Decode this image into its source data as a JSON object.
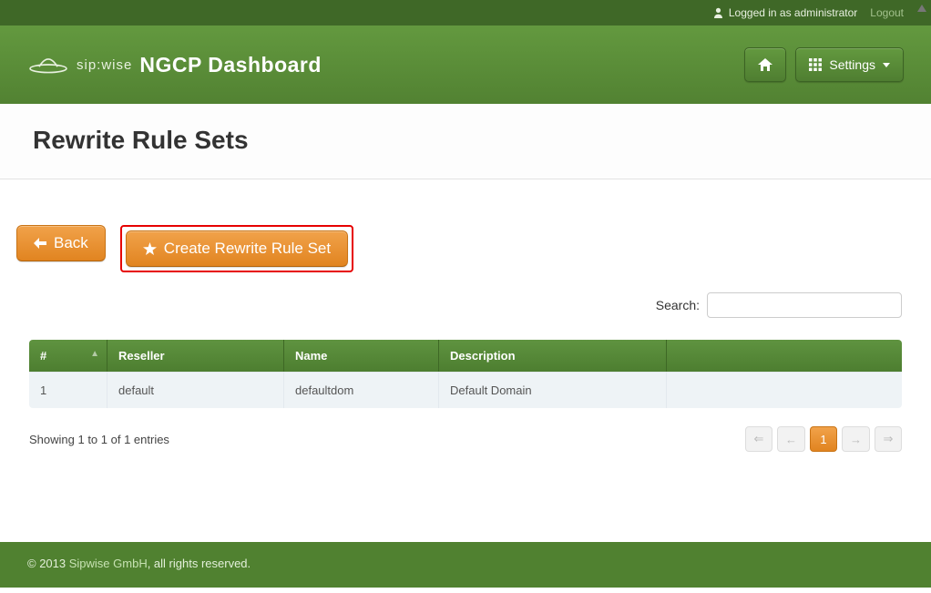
{
  "topbar": {
    "logged_in_label": "Logged in as administrator",
    "logout_label": "Logout"
  },
  "brand": {
    "mark": "sip:wise",
    "title": "NGCP Dashboard"
  },
  "header_buttons": {
    "settings_label": "Settings"
  },
  "page": {
    "title": "Rewrite Rule Sets"
  },
  "actions": {
    "back_label": "Back",
    "create_label": "Create Rewrite Rule Set"
  },
  "search": {
    "label": "Search:",
    "value": ""
  },
  "table": {
    "columns": {
      "id": "#",
      "reseller": "Reseller",
      "name": "Name",
      "description": "Description"
    },
    "rows": [
      {
        "id": "1",
        "reseller": "default",
        "name": "defaultdom",
        "description": "Default Domain"
      }
    ]
  },
  "pagination": {
    "info": "Showing 1 to 1 of 1 entries",
    "first": "⇐",
    "prev": "←",
    "current": "1",
    "next": "→",
    "last": "⇒"
  },
  "footer": {
    "copyright_prefix": "© 2013 ",
    "company": "Sipwise GmbH",
    "copyright_suffix": ", all rights reserved."
  },
  "colors": {
    "green_dark": "#3f6827",
    "green": "#5f9340",
    "orange": "#e78b27",
    "highlight": "#e60000"
  }
}
